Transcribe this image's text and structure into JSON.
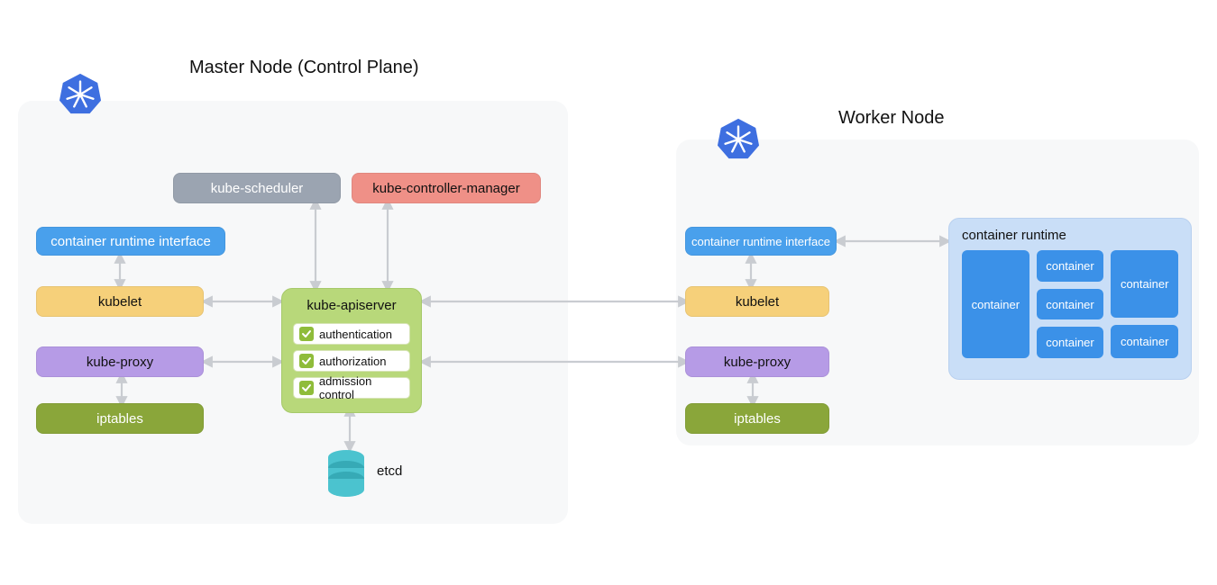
{
  "master": {
    "title": "Master Node (Control Plane)",
    "cri": "container runtime interface",
    "kubelet": "kubelet",
    "kubeproxy": "kube-proxy",
    "iptables": "iptables",
    "scheduler": "kube-scheduler",
    "controller": "kube-controller-manager",
    "apiserver": {
      "label": "kube-apiserver",
      "auth": "authentication",
      "authz": "authorization",
      "admission": "admission control"
    },
    "etcd": "etcd"
  },
  "worker": {
    "title": "Worker Node",
    "cri": "container runtime interface",
    "kubelet": "kubelet",
    "kubeproxy": "kube-proxy",
    "iptables": "iptables",
    "runtime": {
      "label": "container runtime",
      "c1": "container",
      "c2": "container",
      "c3": "container",
      "c4": "container",
      "c5": "container",
      "c6": "container"
    }
  },
  "colors": {
    "panel": "#f7f8f9",
    "blue": "#49a0ec",
    "yellow": "#f6d07a",
    "purple": "#b69be6",
    "olive": "#8aa63a",
    "grey": "#9ba4b1",
    "red": "#ef9087",
    "apiserver": "#b8d87a",
    "runtimeBox": "#c9def7",
    "container": "#3b91e8",
    "etcd": "#4bc3cf",
    "k8sIcon": "#3e6fe0",
    "arrow": "#c9ccd1"
  }
}
